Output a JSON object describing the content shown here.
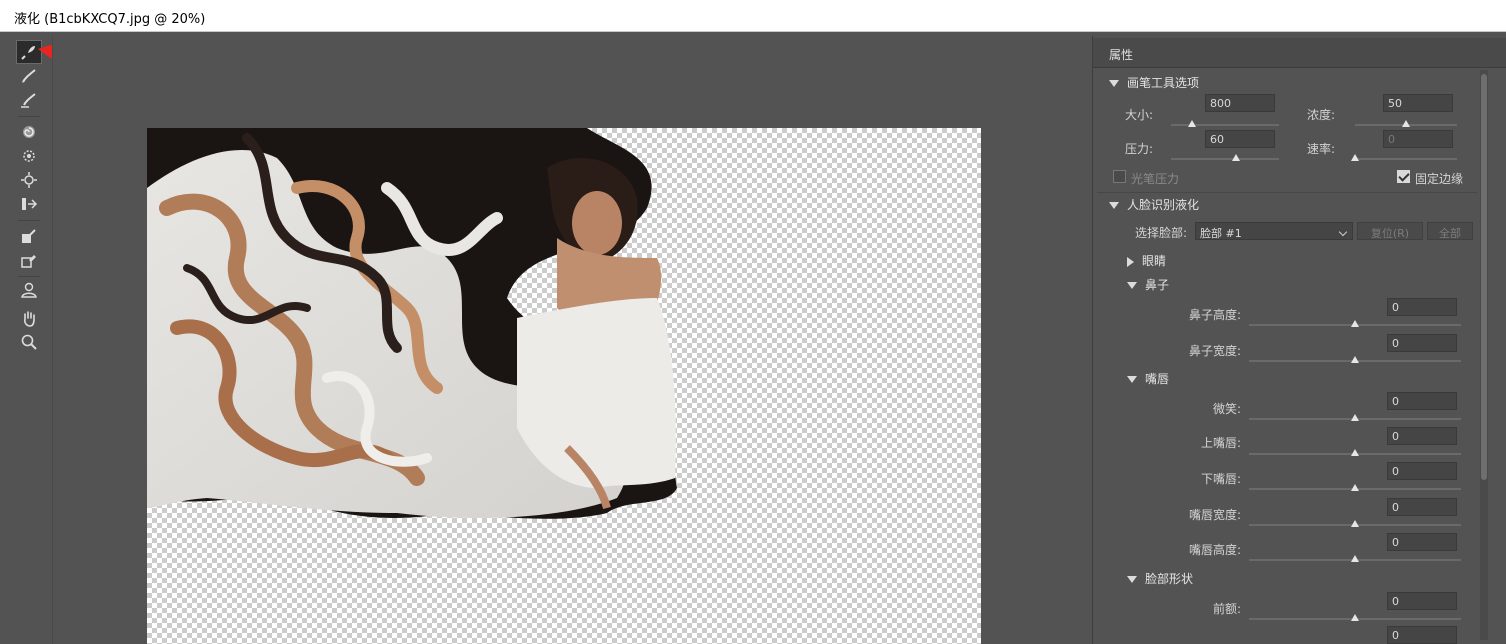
{
  "window": {
    "title": "液化 (B1cbKXCQ7.jpg @ 20%)"
  },
  "tools": [
    {
      "name": "forward-warp-tool-icon",
      "active": true
    },
    {
      "name": "reconstruct-tool-icon"
    },
    {
      "name": "smooth-tool-icon"
    },
    {
      "name": "twirl-tool-icon"
    },
    {
      "name": "pucker-tool-icon"
    },
    {
      "name": "bloat-tool-icon"
    },
    {
      "name": "push-left-tool-icon"
    },
    {
      "name": "freeze-mask-tool-icon"
    },
    {
      "name": "thaw-mask-tool-icon"
    },
    {
      "name": "face-tool-icon"
    },
    {
      "name": "hand-tool-icon"
    },
    {
      "name": "zoom-tool-icon"
    }
  ],
  "colors": {
    "annotation_arrow": "#e8261f",
    "panel_bg": "#535353"
  },
  "panel": {
    "title": "属性",
    "brush": {
      "header": "画笔工具选项",
      "size_label": "大小:",
      "size_value": "800",
      "size_fraction": 0.19,
      "density_label": "浓度:",
      "density_value": "50",
      "density_fraction": 0.5,
      "pressure_label": "压力:",
      "pressure_value": "60",
      "pressure_fraction": 0.6,
      "rate_label": "速率:",
      "rate_value": "0",
      "rate_fraction": 0.0,
      "stylus_label": "光笔压力",
      "stylus_checked": false,
      "pin_edges_label": "固定边缘",
      "pin_edges_checked": true
    },
    "face": {
      "header": "人脸识别液化",
      "select_face_label": "选择脸部:",
      "select_face_value": "脸部 #1",
      "reset_label": "复位(R)",
      "all_label": "全部",
      "eyes_label": "眼睛",
      "nose_label": "鼻子",
      "nose_height_label": "鼻子高度:",
      "nose_height_value": "0",
      "nose_width_label": "鼻子宽度:",
      "nose_width_value": "0",
      "mouth_label": "嘴唇",
      "smile_label": "微笑:",
      "smile_value": "0",
      "upper_lip_label": "上嘴唇:",
      "upper_lip_value": "0",
      "lower_lip_label": "下嘴唇:",
      "lower_lip_value": "0",
      "mouth_width_label": "嘴唇宽度:",
      "mouth_width_value": "0",
      "mouth_height_label": "嘴唇高度:",
      "mouth_height_value": "0",
      "face_shape_label": "脸部形状",
      "forehead_label": "前额:",
      "forehead_value": "0",
      "chin_height_value": "0"
    }
  }
}
